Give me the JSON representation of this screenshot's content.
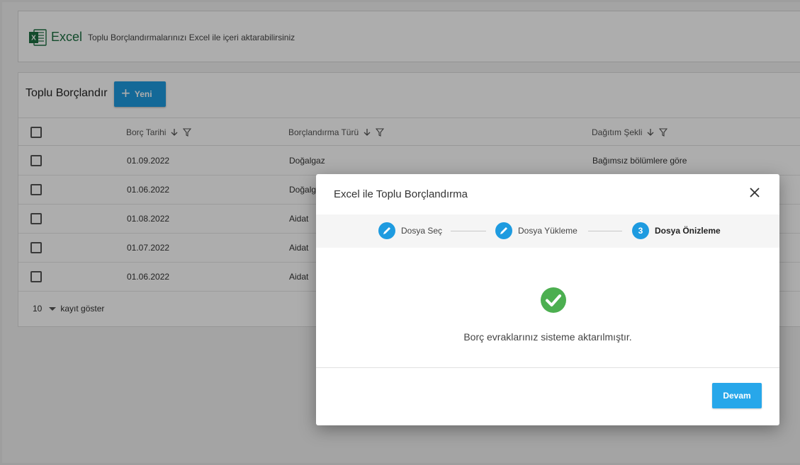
{
  "excel_header": {
    "logo_icon": "excel-icon",
    "word": "Excel",
    "description": "Toplu Borçlandırmalarınızı Excel ile içeri aktarabilirsiniz"
  },
  "card": {
    "title": "Toplu Borçlandır",
    "new_button_label": "Yeni",
    "columns": [
      {
        "label": "Borç Tarihi"
      },
      {
        "label": "Borçlandırma Türü"
      },
      {
        "label": "Dağıtım Şekli"
      }
    ],
    "rows": [
      {
        "date": "01.09.2022",
        "type": "Doğalgaz",
        "distribution": "Bağımsız bölümlere göre"
      },
      {
        "date": "01.06.2022",
        "type": "Doğalgaz",
        "distribution": ""
      },
      {
        "date": "01.08.2022",
        "type": "Aidat",
        "distribution": ""
      },
      {
        "date": "01.07.2022",
        "type": "Aidat",
        "distribution": ""
      },
      {
        "date": "01.06.2022",
        "type": "Aidat",
        "distribution": ""
      }
    ],
    "pager": {
      "page_size": "10",
      "label": "kayıt göster"
    }
  },
  "modal": {
    "title": "Excel ile Toplu Borçlandırma",
    "steps": [
      {
        "label": "Dosya Seç",
        "icon": "pencil-icon"
      },
      {
        "label": "Dosya Yükleme",
        "icon": "pencil-icon"
      },
      {
        "label": "Dosya Önizleme",
        "number": "3"
      }
    ],
    "message": "Borç evraklarınız sisteme aktarılmıştır.",
    "continue_label": "Devam"
  },
  "colors": {
    "accent": "#1e9be0",
    "success": "#4caf50",
    "excel_green": "#1d6f42"
  }
}
